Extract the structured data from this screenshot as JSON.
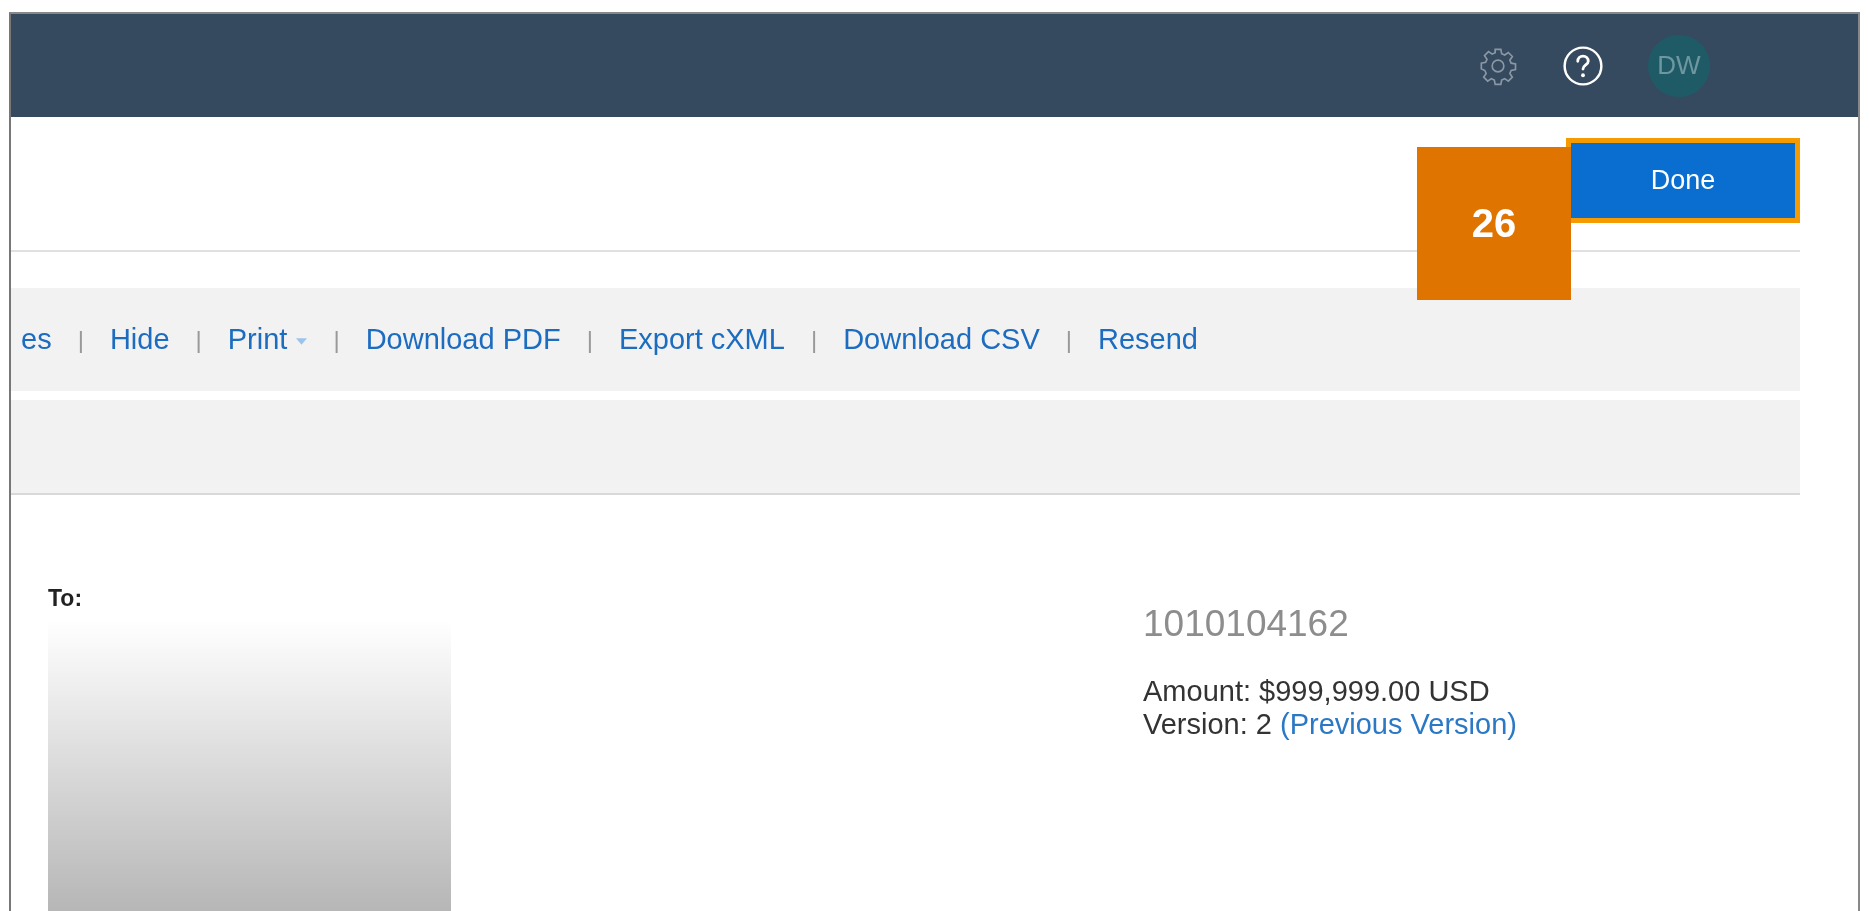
{
  "top_bar": {
    "avatar_initials": "DW"
  },
  "done_button": {
    "label": "Done"
  },
  "step_badge": {
    "label": "26"
  },
  "toolbar": {
    "separator": "|",
    "items": [
      {
        "label": "es",
        "dropdown": false
      },
      {
        "label": "Hide",
        "dropdown": false
      },
      {
        "label": "Print",
        "dropdown": true
      },
      {
        "label": "Download PDF",
        "dropdown": false
      },
      {
        "label": "Export cXML",
        "dropdown": false
      },
      {
        "label": "Download CSV",
        "dropdown": false
      },
      {
        "label": "Resend",
        "dropdown": false
      }
    ]
  },
  "recipient": {
    "label": "To:"
  },
  "order": {
    "number": "1010104162",
    "amount": "Amount: $999,999.00 USD",
    "version": "Version: 2",
    "previous_version_link": "(Previous Version)"
  }
}
